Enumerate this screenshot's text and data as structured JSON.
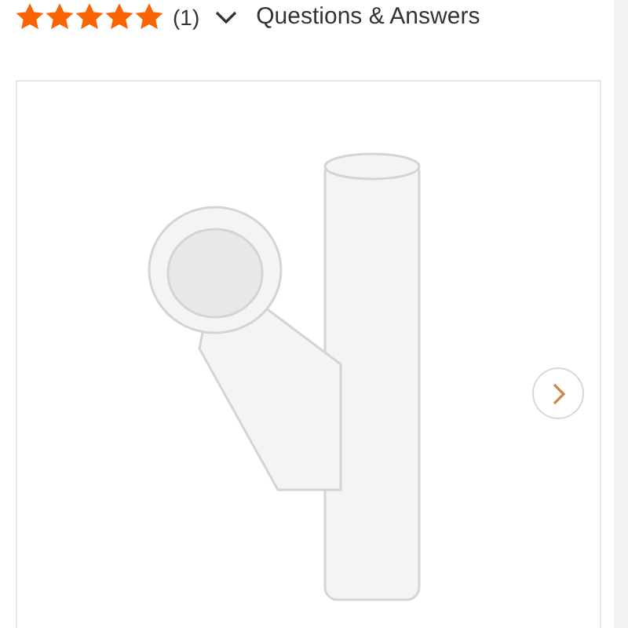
{
  "rating": {
    "stars": 5,
    "count": "(1)"
  },
  "questions_link": {
    "label": "Questions & Answers",
    "expanded": false
  }
}
